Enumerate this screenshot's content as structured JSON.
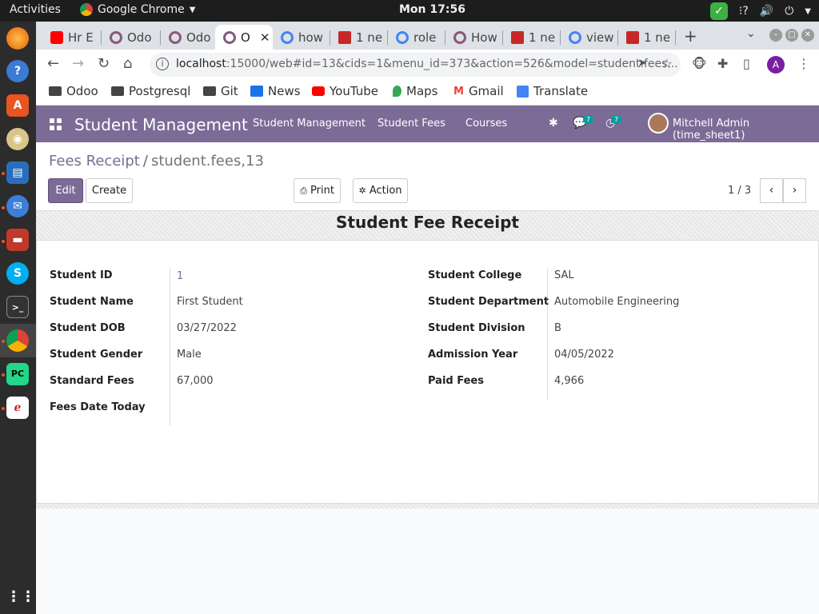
{
  "topbar": {
    "activities": "Activities",
    "app_name": "Google Chrome",
    "clock": "Mon 17:56"
  },
  "chrome": {
    "tabs": [
      {
        "label": "Hr E",
        "favicon_color": "#ff0000"
      },
      {
        "label": "Odo",
        "favicon_color": "#875a7b"
      },
      {
        "label": "Odo",
        "favicon_color": "#875a7b"
      },
      {
        "label": "O",
        "favicon_color": "#875a7b"
      },
      {
        "label": "how",
        "favicon_color": "#4285f4"
      },
      {
        "label": "1 ne",
        "favicon_color": "#c62828"
      },
      {
        "label": "role",
        "favicon_color": "#4285f4"
      },
      {
        "label": "How",
        "favicon_color": "#875a7b"
      },
      {
        "label": "1 ne",
        "favicon_color": "#c62828"
      },
      {
        "label": "view",
        "favicon_color": "#4285f4"
      },
      {
        "label": "1 ne",
        "favicon_color": "#c62828"
      }
    ],
    "url_host": "localhost",
    "url_rest": ":15000/web#id=13&cids=1&menu_id=373&action=526&model=student.fees...",
    "profile_initial": "A",
    "bookmarks": [
      "Odoo",
      "Postgresql",
      "Git",
      "News",
      "YouTube",
      "Maps",
      "Gmail",
      "Translate"
    ]
  },
  "odoo": {
    "brand": "Student Management",
    "menu": [
      "Student Management",
      "Student Fees",
      "Courses"
    ],
    "chat_badge": "7",
    "activity_badge": "7",
    "user": "Mitchell Admin (time_sheet1)",
    "breadcrumb_parent": "Fees Receipt",
    "breadcrumb_sep": "/",
    "breadcrumb_current": "student.fees,13",
    "edit_label": "Edit",
    "create_label": "Create",
    "print_label": "Print",
    "action_label": "Action",
    "pager": "1 / 3",
    "accent_color": "#7c6b97"
  },
  "form": {
    "title": "Student Fee Receipt",
    "left": [
      {
        "label": "Student ID",
        "value": "1"
      },
      {
        "label": "Student Name",
        "value": "First Student"
      },
      {
        "label": "Student DOB",
        "value": "03/27/2022"
      },
      {
        "label": "Student Gender",
        "value": "Male"
      },
      {
        "label": "Standard Fees",
        "value": "67,000"
      },
      {
        "label": "Fees Date Today",
        "value": ""
      }
    ],
    "right": [
      {
        "label": "Student College",
        "value": "SAL"
      },
      {
        "label": "Student Department",
        "value": "Automobile Engineering"
      },
      {
        "label": "Student Division",
        "value": "B"
      },
      {
        "label": "Admission Year",
        "value": "04/05/2022"
      },
      {
        "label": "Paid Fees",
        "value": "4,966"
      }
    ]
  }
}
